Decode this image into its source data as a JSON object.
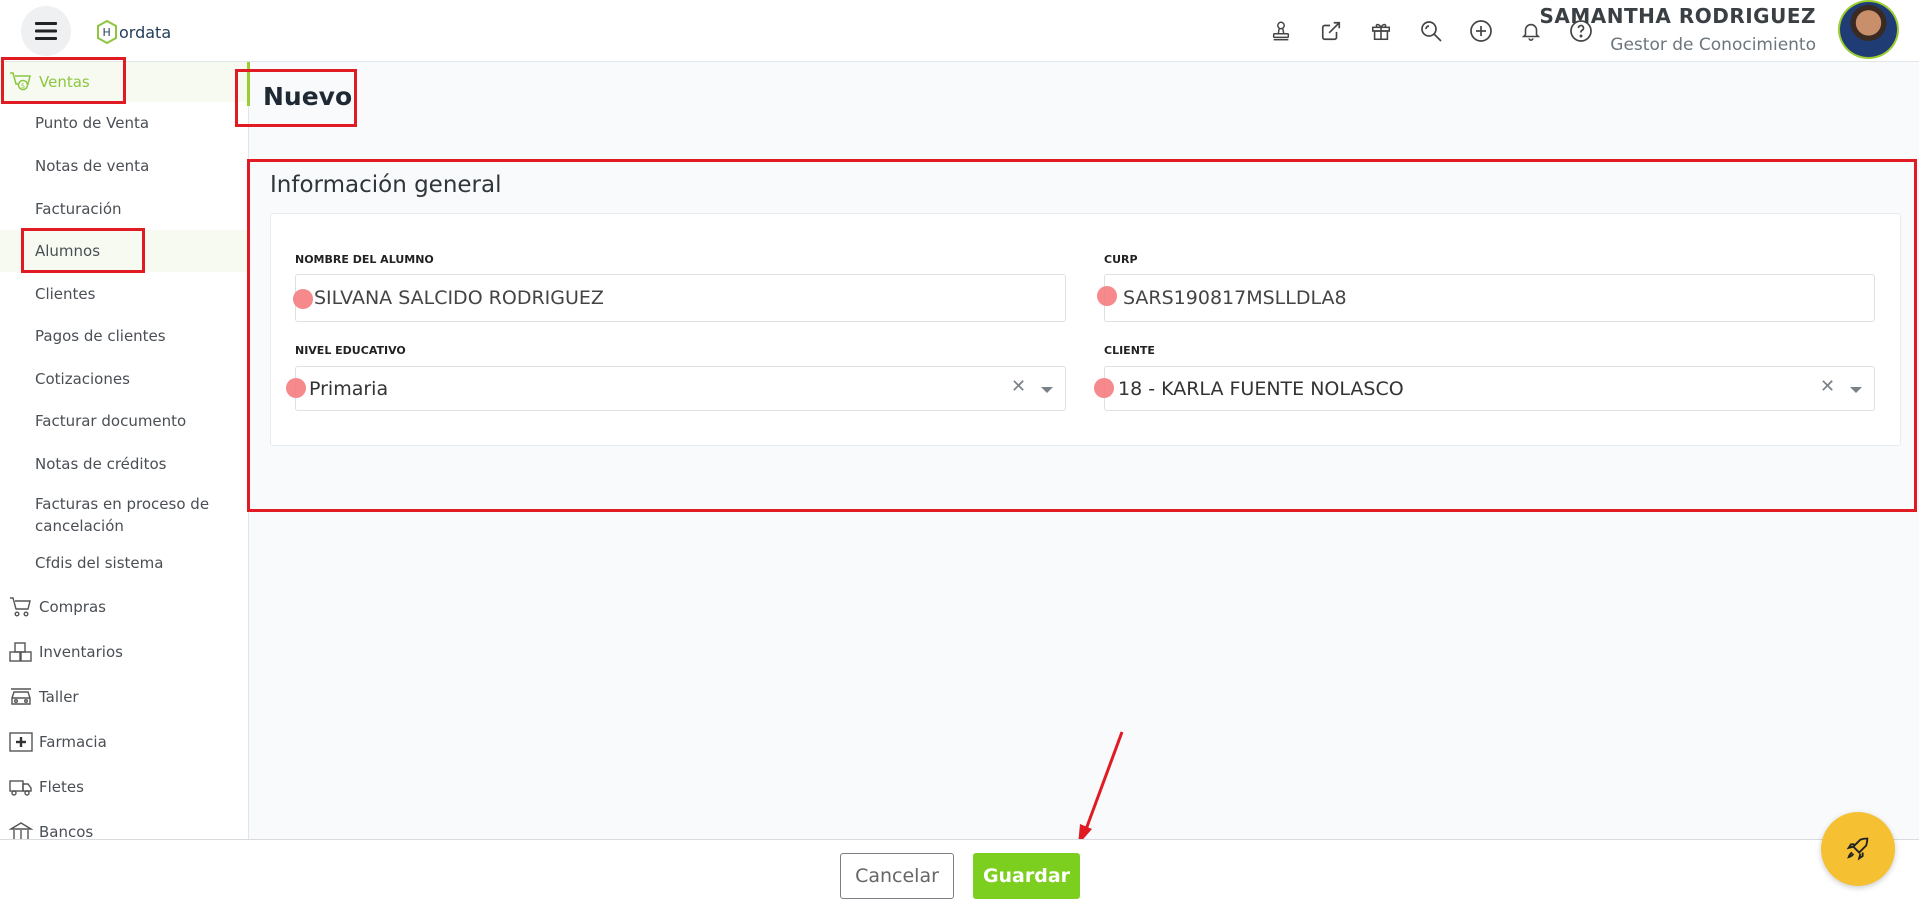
{
  "app": {
    "logo_text": "ordata",
    "logo_letter": "H"
  },
  "header": {
    "user_name": "SAMANTHA RODRIGUEZ",
    "user_role": "Gestor de Conocimiento",
    "icons": [
      "stamp-icon",
      "external-link-icon",
      "gift-icon",
      "search-zoom-icon",
      "plus-circle-icon",
      "bell-icon",
      "help-icon"
    ]
  },
  "sidebar": {
    "ventas": "Ventas",
    "items": [
      "Punto de Venta",
      "Notas de venta",
      "Facturación",
      "Alumnos",
      "Clientes",
      "Pagos de clientes",
      "Cotizaciones",
      "Facturar documento",
      "Notas de créditos",
      "Facturas en proceso de cancelación",
      "Cfdis del sistema"
    ],
    "groups": [
      "Compras",
      "Inventarios",
      "Taller",
      "Farmacia",
      "Fletes",
      "Bancos"
    ]
  },
  "page": {
    "title": "Nuevo",
    "section_title": "Información general"
  },
  "form": {
    "nombre_label": "NOMBRE DEL ALUMNO",
    "nombre_value": "SILVANA SALCIDO RODRIGUEZ",
    "curp_label": "CURP",
    "curp_value": "SARS190817MSLLDLA8",
    "nivel_label": "NIVEL EDUCATIVO",
    "nivel_value": "Primaria",
    "cliente_label": "CLIENTE",
    "cliente_value": "18 - KARLA FUENTE NOLASCO"
  },
  "footer": {
    "cancel_label": "Cancelar",
    "save_label": "Guardar"
  },
  "colors": {
    "accent": "#7ccf1e",
    "annotation": "#e01b24",
    "fab": "#f5c133"
  }
}
